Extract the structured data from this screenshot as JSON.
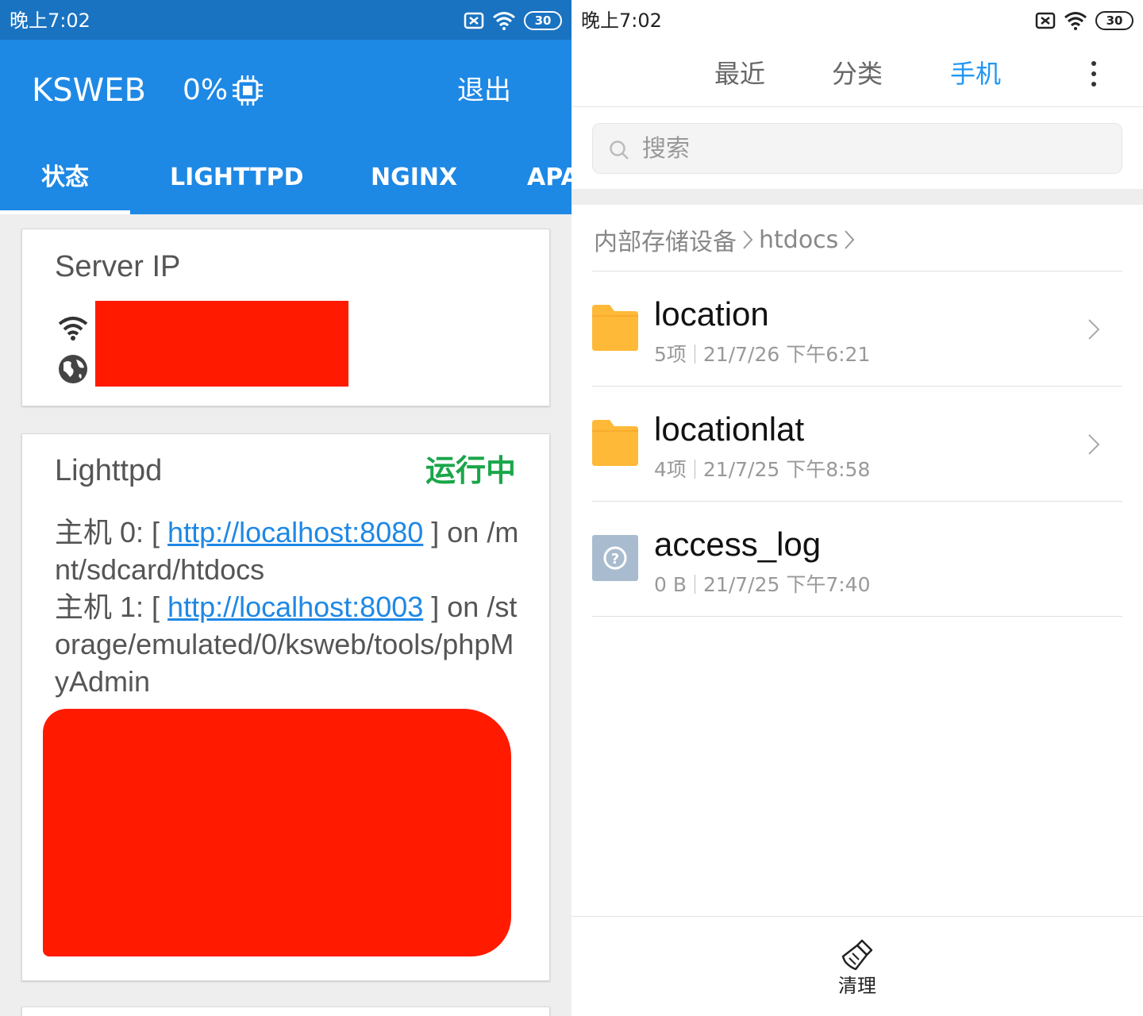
{
  "left": {
    "status_bar": {
      "time": "晚上7:02",
      "battery": "30"
    },
    "app": {
      "title": "KSWEB",
      "cpu_percent": "0%",
      "exit_label": "退出"
    },
    "tabs": [
      "状态",
      "LIGHTTPD",
      "NGINX",
      "APA"
    ],
    "active_tab": 0,
    "server_ip_card": {
      "title": "Server IP"
    },
    "lighttpd_card": {
      "title": "Lighttpd",
      "status": "运行中",
      "status_color": "#1aa64a",
      "hosts": [
        {
          "prefix": "主机 0: [ ",
          "url": "http://localhost:8080",
          "suffix": " ] on /mnt/sdcard/htdocs"
        },
        {
          "prefix": "主机 1: [ ",
          "url": "http://localhost:8003",
          "suffix": " ] on /storage/emulated/0/ksweb/tools/phpMyAdmin"
        }
      ]
    },
    "accent_color": "#1e88e5"
  },
  "right": {
    "status_bar": {
      "time": "晚上7:02",
      "battery": "30"
    },
    "tabs": [
      "最近",
      "分类",
      "手机"
    ],
    "active_tab": 2,
    "search": {
      "placeholder": "搜索"
    },
    "breadcrumb": [
      "内部存储设备",
      "htdocs"
    ],
    "files": [
      {
        "name": "location",
        "count": "5项",
        "date": "21/7/26 下午6:21",
        "type": "folder"
      },
      {
        "name": "locationlat",
        "count": "4项",
        "date": "21/7/25 下午8:58",
        "type": "folder"
      },
      {
        "name": "access_log",
        "count": "0 B",
        "date": "21/7/25 下午7:40",
        "type": "unknown-file"
      }
    ],
    "bottom": {
      "clean_label": "清理"
    },
    "folder_color": "#ffb938",
    "active_color": "#2196f3"
  }
}
